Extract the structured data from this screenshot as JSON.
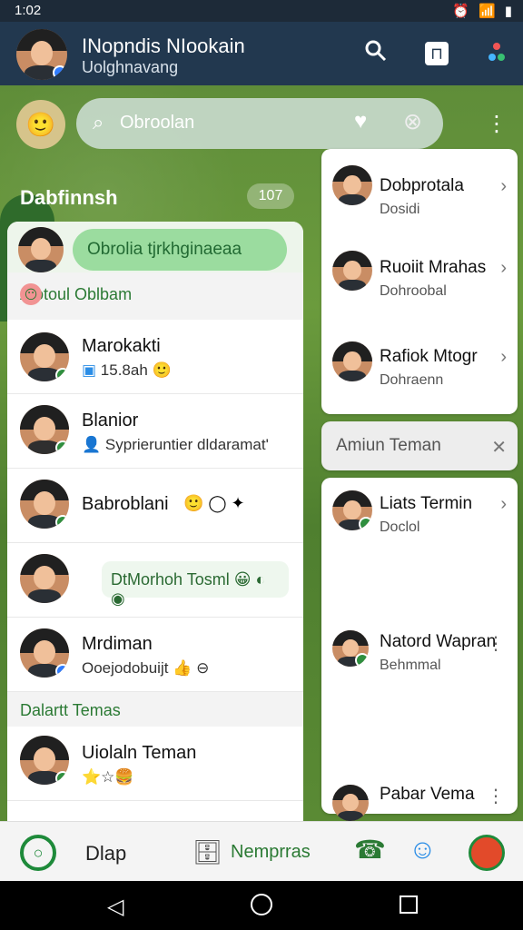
{
  "status": {
    "time": "1:02"
  },
  "header": {
    "name": "INopndis NIookain",
    "subtitle": "Uolghnavang"
  },
  "search": {
    "placeholder": "Obroolan"
  },
  "left": {
    "title": "Dabfinnsh",
    "badge": "107",
    "pill": "Obrolia tjrkhginaeaa",
    "sections": [
      "Alotoul Oblbam",
      "Dalartt Temas"
    ],
    "chats": [
      {
        "name": "Marokakti",
        "sub": "15.8ah"
      },
      {
        "name": "Blanior",
        "sub": "Syprieruntier dldaramat'"
      },
      {
        "name": "Babroblani"
      },
      {
        "bubble": "DtMorhoh Tosml"
      },
      {
        "name": "Mrdiman",
        "sub": "Ooejodobuijt"
      },
      {
        "name": "Uiolaln Teman"
      }
    ]
  },
  "right": {
    "cards": [
      {
        "name": "Dobprotala",
        "sub": "Dosidi"
      },
      {
        "name": "Ruoiit Mrahas",
        "sub": "Dohroobal"
      },
      {
        "name": "Rafiok Mtogr",
        "sub": "Dohraenn"
      },
      {
        "name": "Amiun Teman"
      },
      {
        "name": "Liats Termin",
        "sub": "Doclol"
      },
      {
        "name": "Natord Wapran",
        "sub": "Behmmal"
      },
      {
        "name": "Pabar Vema"
      }
    ]
  },
  "bottom": {
    "tab1": "Dlap",
    "tab2": "Nemprras"
  }
}
